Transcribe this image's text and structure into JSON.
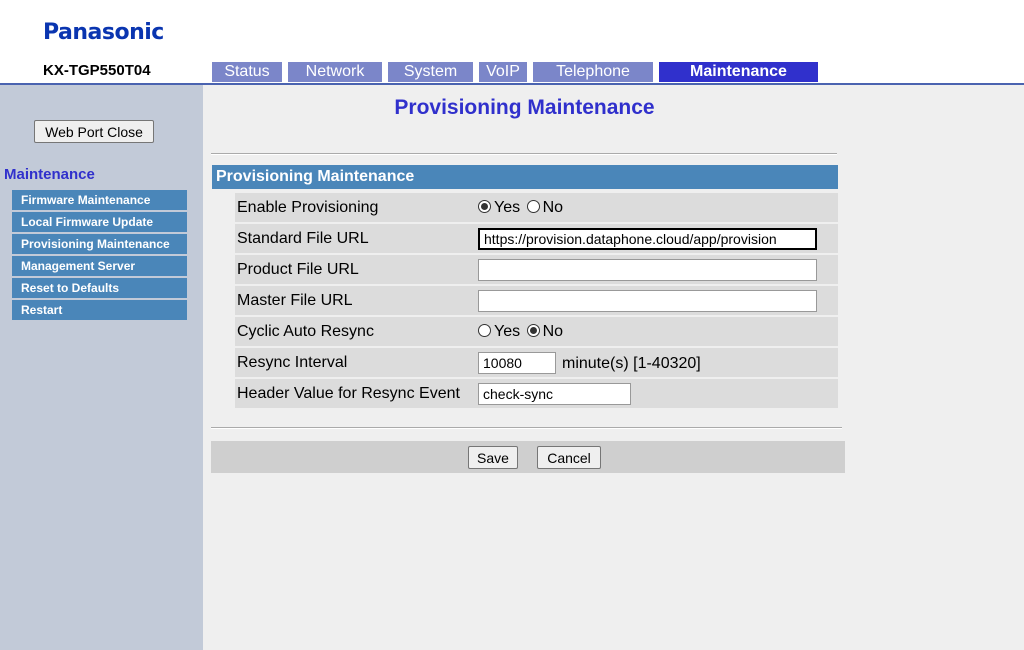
{
  "header": {
    "brand": "Panasonic",
    "model": "KX-TGP550T04",
    "tabs": [
      {
        "label": "Status",
        "active": false
      },
      {
        "label": "Network",
        "active": false
      },
      {
        "label": "System",
        "active": false
      },
      {
        "label": "VoIP",
        "active": false
      },
      {
        "label": "Telephone",
        "active": false
      },
      {
        "label": "Maintenance",
        "active": true
      }
    ]
  },
  "sidebar": {
    "web_port_close": "Web Port Close",
    "title": "Maintenance",
    "items": [
      "Firmware Maintenance",
      "Local Firmware Update",
      "Provisioning Maintenance",
      "Management Server",
      "Reset to Defaults",
      "Restart"
    ]
  },
  "main": {
    "page_title": "Provisioning Maintenance",
    "section_title": "Provisioning Maintenance",
    "fields": {
      "enable_provisioning": {
        "label": "Enable Provisioning",
        "yes": "Yes",
        "no": "No",
        "selected": "Yes"
      },
      "standard_file_url": {
        "label": "Standard File URL",
        "value": "https://provision.dataphone.cloud/app/provision"
      },
      "product_file_url": {
        "label": "Product File URL",
        "value": ""
      },
      "master_file_url": {
        "label": "Master File URL",
        "value": ""
      },
      "cyclic_auto_resync": {
        "label": "Cyclic Auto Resync",
        "yes": "Yes",
        "no": "No",
        "selected": "No"
      },
      "resync_interval": {
        "label": "Resync Interval",
        "value": "10080",
        "unit": "minute(s) [1-40320]"
      },
      "header_value": {
        "label": "Header Value for Resync Event",
        "value": "check-sync"
      }
    },
    "buttons": {
      "save": "Save",
      "cancel": "Cancel"
    }
  },
  "colors": {
    "brand": "#0a35b0",
    "accent": "#3030cc",
    "tab_inactive": "#7b86c9",
    "menu_bg": "#4a86b9"
  }
}
